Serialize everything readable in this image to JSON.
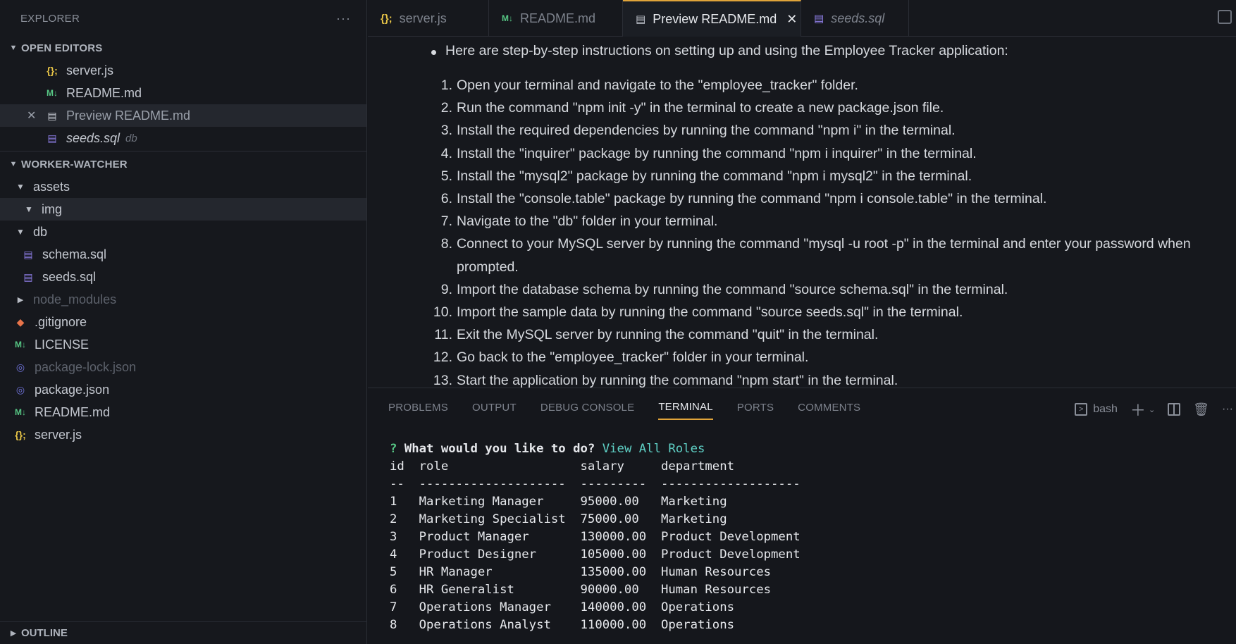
{
  "explorer": {
    "title": "EXPLORER",
    "more": "···",
    "open_editors": {
      "label": "OPEN EDITORS",
      "items": [
        {
          "name": "server.js",
          "icon": "js-icon"
        },
        {
          "name": "README.md",
          "icon": "markdown-icon"
        },
        {
          "name": "Preview README.md",
          "icon": "preview-icon"
        },
        {
          "name": "seeds.sql",
          "icon": "database-icon",
          "folder": "db"
        }
      ]
    },
    "project": {
      "label": "WORKER-WATCHER",
      "assets": "assets",
      "img": "img",
      "db": "db",
      "schema": "schema.sql",
      "seeds": "seeds.sql",
      "node_modules": "node_modules",
      "gitignore": ".gitignore",
      "license": "LICENSE",
      "package_lock": "package-lock.json",
      "package": "package.json",
      "readme": "README.md",
      "server": "server.js"
    },
    "outline": "OUTLINE"
  },
  "tabs": [
    {
      "label": "server.js"
    },
    {
      "label": "README.md"
    },
    {
      "label": "Preview README.md"
    },
    {
      "label": "seeds.sql"
    }
  ],
  "preview": {
    "intro": "Here are step-by-step instructions on setting up and using the Employee Tracker application:",
    "steps": [
      "Open your terminal and navigate to the \"employee_tracker\" folder.",
      "Run the command \"npm init -y\" in the terminal to create a new package.json file.",
      "Install the required dependencies by running the command \"npm i\" in the terminal.",
      "Install the \"inquirer\" package by running the command \"npm i inquirer\" in the terminal.",
      "Install the \"mysql2\" package by running the command \"npm i mysql2\" in the terminal.",
      "Install the \"console.table\" package by running the command \"npm i console.table\" in the terminal.",
      "Navigate to the \"db\" folder in your terminal.",
      "Connect to your MySQL server by running the command \"mysql -u root -p\" in the terminal and enter your password when prompted.",
      "Import the database schema by running the command \"source schema.sql\" in the terminal.",
      "Import the sample data by running the command \"source seeds.sql\" in the terminal.",
      "Exit the MySQL server by running the command \"quit\" in the terminal.",
      "Go back to the \"employee_tracker\" folder in your terminal.",
      "Start the application by running the command \"npm start\" in the terminal."
    ]
  },
  "panel": {
    "tabs": [
      "PROBLEMS",
      "OUTPUT",
      "DEBUG CONSOLE",
      "TERMINAL",
      "PORTS",
      "COMMENTS"
    ],
    "shell": "bash"
  },
  "terminal": {
    "prompt_mark": "?",
    "question": "What would you like to do?",
    "answer": "View All Roles",
    "header": "id  role                  salary     department",
    "divider": "--  --------------------  ---------  -------------------",
    "rows": [
      "1   Marketing Manager     95000.00   Marketing",
      "2   Marketing Specialist  75000.00   Marketing",
      "3   Product Manager       130000.00  Product Development",
      "4   Product Designer      105000.00  Product Development",
      "5   HR Manager            135000.00  Human Resources",
      "6   HR Generalist         90000.00   Human Resources",
      "7   Operations Manager    140000.00  Operations",
      "8   Operations Analyst    110000.00  Operations"
    ]
  }
}
